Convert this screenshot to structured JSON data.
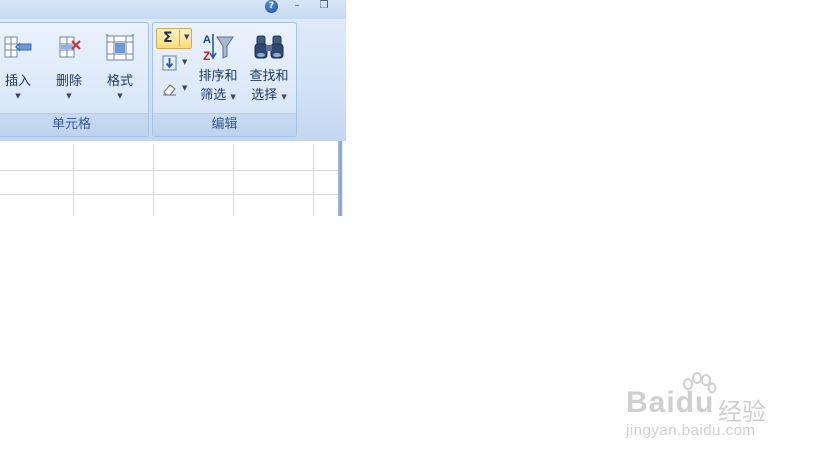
{
  "title_bar": {
    "help_glyph": "?",
    "minimize_glyph": "–",
    "restore_glyph": "❒"
  },
  "ribbon": {
    "cells_group": {
      "label": "单元格",
      "insert": {
        "label": "插入",
        "icon": "insert-cells-icon"
      },
      "delete": {
        "label": "删除",
        "icon": "delete-cells-icon"
      },
      "format": {
        "label": "格式",
        "icon": "format-cells-icon"
      }
    },
    "editing_group": {
      "label": "编辑",
      "autosum": {
        "glyph": "Σ",
        "icon": "autosum-icon"
      },
      "fill": {
        "icon": "fill-down-icon"
      },
      "clear": {
        "icon": "eraser-icon"
      },
      "sort_filter": {
        "line1": "排序和",
        "line2": "筛选",
        "icon": "sort-filter-icon"
      },
      "find_select": {
        "line1": "查找和",
        "line2": "选择",
        "icon": "binoculars-icon"
      }
    }
  },
  "watermark": {
    "brand": "Baidu",
    "brand_cn": "经验",
    "url": "jingyan.baidu.com"
  },
  "colors": {
    "ribbon_bg": "#dbe8f9",
    "group_label": "#3d5a8a",
    "autosum_highlight": "#ffd97a",
    "gridline": "#d4d8de"
  }
}
